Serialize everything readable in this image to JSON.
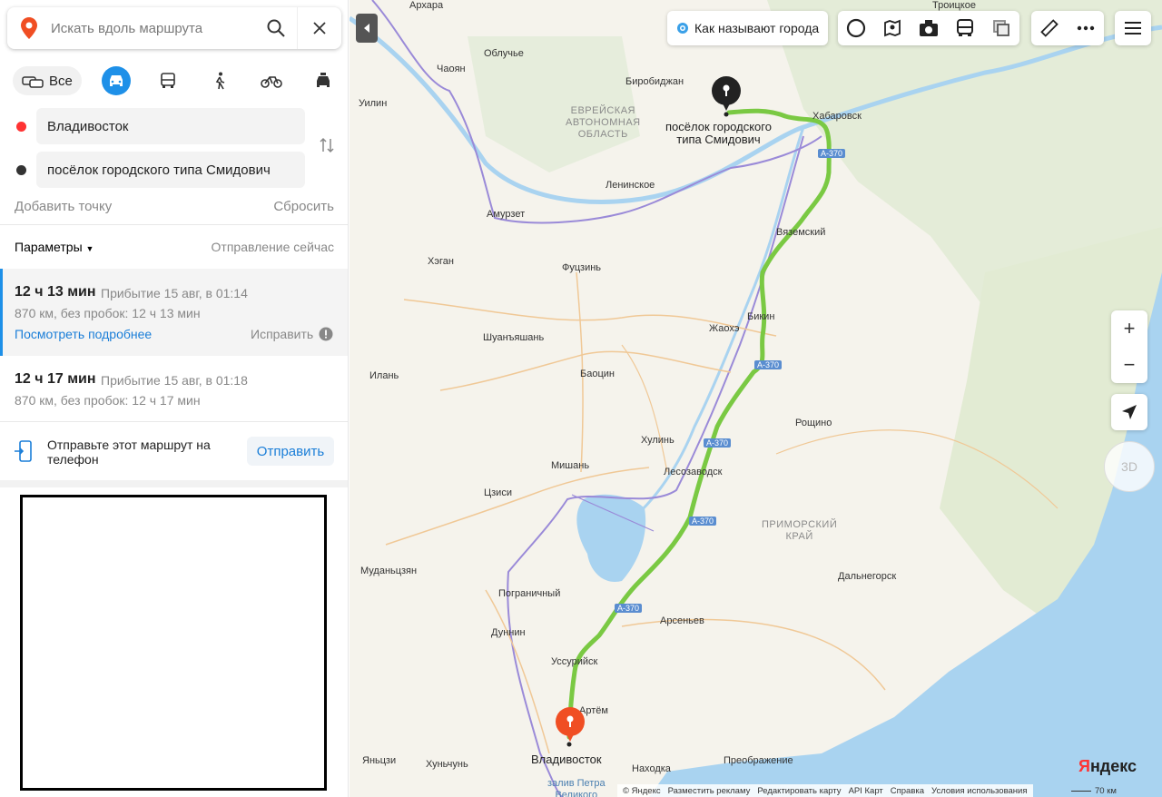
{
  "search": {
    "placeholder": "Искать вдоль маршрута"
  },
  "modes": {
    "all_label": "Все",
    "active": "car"
  },
  "route_points": {
    "from": "Владивосток",
    "to": "посёлок городского типа Смидович"
  },
  "actions": {
    "add_point": "Добавить точку",
    "reset": "Сбросить"
  },
  "params": {
    "label": "Параметры",
    "departure": "Отправление сейчас"
  },
  "routes": [
    {
      "time": "12 ч 13 мин",
      "arrival": "Прибытие 15 авг, в 01:14",
      "details": "870 км, без пробок: 12 ч 13 мин",
      "more": "Посмотреть подробнее",
      "fix": "Исправить"
    },
    {
      "time": "12 ч 17 мин",
      "arrival": "Прибытие 15 авг, в 01:18",
      "details": "870 км, без пробок: 12 ч 17 мин"
    }
  ],
  "send": {
    "text": "Отправьте этот маршрут на телефон",
    "button": "Отправить"
  },
  "map": {
    "cities_button": "Как называют города",
    "labels": {
      "arkhara": "Архара",
      "obluchye": "Облучье",
      "chaoyan": "Чаоян",
      "birobidzhan": "Биробиджан",
      "uilin": "Уилин",
      "jao_line1": "ЕВРЕЙСКАЯ",
      "jao_line2": "АВТОНОМНАЯ",
      "jao_line3": "ОБЛАСТЬ",
      "khabarovsk": "Хабаровск",
      "leninskoe": "Ленинское",
      "amurzet": "Амурзет",
      "vyazemsky": "Вяземский",
      "khegan": "Хэган",
      "fuczin": "Фуцзинь",
      "bikin": "Бикин",
      "zhaokhe": "Жаохэ",
      "shuanyashan": "Шуанъяшань",
      "ilan": "Илань",
      "baocin": "Баоцин",
      "roshchino": "Рощино",
      "khulin": "Хулинь",
      "mishan": "Мишань",
      "lesozavodsk": "Лесозаводск",
      "czisi": "Цзиси",
      "primorsky_line1": "ПРИМОРСКИЙ",
      "primorsky_line2": "КРАЙ",
      "mudanczyan": "Муданьцзян",
      "dalnegorsk": "Дальнегорск",
      "pogranichny": "Пограничный",
      "arsenyev": "Арсеньев",
      "dunnin": "Дуннин",
      "ussuriysk": "Уссурийск",
      "artem": "Артём",
      "vladivostok": "Владивосток",
      "nakhodka": "Находка",
      "preobrazhenie": "Преображение",
      "yanczi": "Яньцзи",
      "khunchun": "Хуньчунь",
      "troitskoe": "Троицкое",
      "sea_line1": "залив Петра",
      "sea_line2": "Великого",
      "dest_line1": "посёлок городского",
      "dest_line2": "типа Смидович"
    },
    "highway": "А-370",
    "zoom_in": "+",
    "zoom_out": "−",
    "compass": "3D",
    "logo_y": "Я",
    "logo_rest": "ндекс",
    "footer": [
      "© Яндекс",
      "Разместить рекламу",
      "Редактировать карту",
      "API Карт",
      "Справка",
      "Условия использования"
    ],
    "scale": "70 км",
    "colors": {
      "route": "#7ac943",
      "water": "#a9d3f0",
      "border": "#9a8ad8",
      "road": "#f0c896",
      "start_pin": "#f04e23",
      "end_pin": "#222222"
    }
  }
}
